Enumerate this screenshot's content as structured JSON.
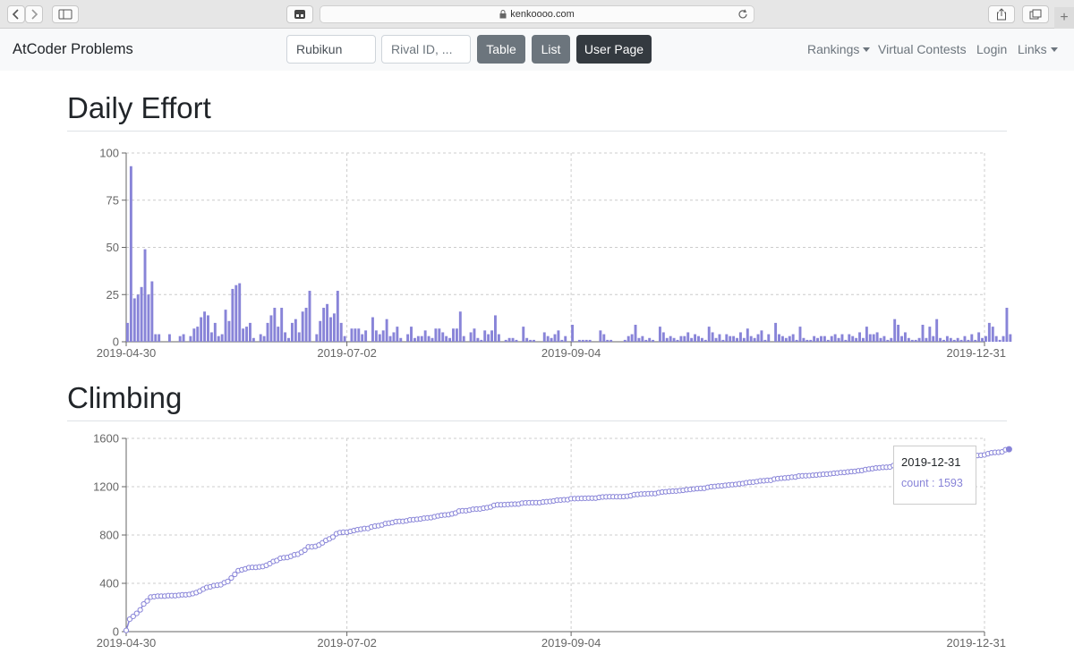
{
  "browser": {
    "url": "kenkoooo.com"
  },
  "navbar": {
    "brand": "AtCoder Problems",
    "user_input_value": "Rubikun",
    "rival_placeholder": "Rival ID, ...",
    "table_label": "Table",
    "list_label": "List",
    "user_page_label": "User Page",
    "rankings_label": "Rankings",
    "virtual_contests_label": "Virtual Contests",
    "login_label": "Login",
    "links_label": "Links"
  },
  "daily_effort": {
    "heading": "Daily Effort"
  },
  "climbing": {
    "heading": "Climbing",
    "tooltip": {
      "date": "2019-12-31",
      "label": "count : 1593"
    }
  },
  "colors": {
    "series": "#8884d8",
    "grid": "#cccccc",
    "axis": "#666666"
  },
  "chart_data": [
    {
      "type": "bar",
      "title": "Daily Effort",
      "x_start": "2019-04-30",
      "x_end": "2019-12-31",
      "x_ticks": [
        "2019-04-30",
        "2019-07-02",
        "2019-09-04",
        "2019-12-31"
      ],
      "y_ticks": [
        0,
        25,
        50,
        75,
        100
      ],
      "ylim": [
        0,
        100
      ],
      "grid": true,
      "values": [
        10,
        93,
        23,
        25,
        29,
        49,
        25,
        32,
        4,
        4,
        0,
        0,
        4,
        0,
        0,
        3,
        4,
        0,
        3,
        7,
        8,
        13,
        16,
        14,
        5,
        10,
        3,
        4,
        17,
        11,
        28,
        30,
        31,
        7,
        8,
        10,
        2,
        0,
        4,
        3,
        10,
        14,
        18,
        8,
        18,
        5,
        2,
        10,
        12,
        5,
        16,
        18,
        27,
        0,
        4,
        11,
        18,
        20,
        13,
        15,
        27,
        10,
        3,
        0,
        7,
        7,
        7,
        4,
        6,
        0,
        13,
        6,
        4,
        6,
        12,
        3,
        5,
        8,
        2,
        0,
        4,
        8,
        2,
        3,
        3,
        6,
        3,
        2,
        7,
        7,
        5,
        3,
        2,
        7,
        7,
        16,
        3,
        0,
        5,
        7,
        2,
        1,
        6,
        4,
        6,
        14,
        4,
        0,
        1,
        2,
        2,
        1,
        0,
        8,
        2,
        1,
        1,
        0,
        0,
        5,
        3,
        2,
        4,
        6,
        1,
        3,
        0,
        9,
        0,
        1,
        1,
        1,
        1,
        0,
        0,
        6,
        4,
        1,
        1,
        0,
        0,
        0,
        1,
        3,
        4,
        9,
        2,
        3,
        1,
        2,
        1,
        0,
        8,
        5,
        2,
        3,
        2,
        1,
        3,
        3,
        5,
        2,
        4,
        3,
        2,
        1,
        8,
        5,
        2,
        4,
        1,
        4,
        3,
        3,
        2,
        5,
        2,
        7,
        3,
        2,
        4,
        6,
        1,
        4,
        0,
        10,
        4,
        3,
        2,
        3,
        4,
        1,
        8,
        2,
        1,
        1,
        3,
        2,
        3,
        3,
        1,
        3,
        4,
        2,
        4,
        1,
        4,
        3,
        2,
        5,
        2,
        8,
        4,
        4,
        5,
        2,
        3,
        1,
        2,
        12,
        9,
        3,
        5,
        2,
        1,
        1,
        2,
        9,
        2,
        8,
        3,
        12,
        2,
        1,
        3,
        2,
        1,
        2,
        1,
        3,
        1,
        4,
        1,
        5,
        2,
        3,
        10,
        8,
        3,
        1,
        3,
        18,
        4
      ]
    },
    {
      "type": "line",
      "title": "Climbing",
      "x_start": "2019-04-30",
      "x_end": "2019-12-31",
      "x_ticks": [
        "2019-04-30",
        "2019-07-02",
        "2019-09-04",
        "2019-12-31"
      ],
      "y_ticks": [
        0,
        400,
        800,
        1200,
        1600
      ],
      "ylim": [
        0,
        1600
      ],
      "grid": true,
      "final_point": {
        "x": "2019-12-31",
        "count": 1593
      },
      "series_name": "count",
      "derived_from": "cumulative sum of Daily Effort"
    }
  ]
}
